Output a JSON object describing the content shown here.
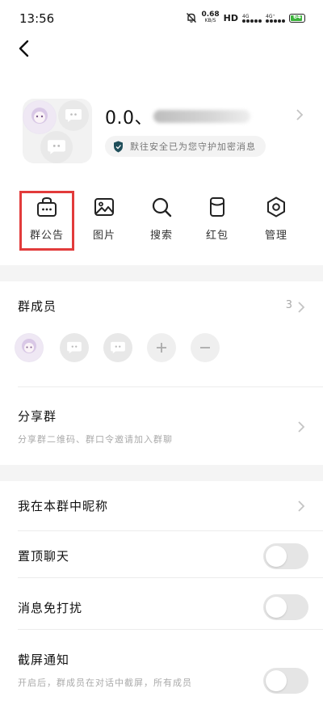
{
  "status": {
    "time": "13:56",
    "speed_value": "0.68",
    "speed_unit": "KB/S",
    "hd": "HD",
    "sig1": "4G",
    "sig2": "4G⁺",
    "battery": "64"
  },
  "group": {
    "name": "0.0、",
    "secure_text": "默往安全已为您守护加密消息"
  },
  "quick_actions": [
    {
      "label": "群公告",
      "icon": "bag-icon"
    },
    {
      "label": "图片",
      "icon": "image-icon"
    },
    {
      "label": "搜索",
      "icon": "search-icon"
    },
    {
      "label": "红包",
      "icon": "red-packet-icon"
    },
    {
      "label": "管理",
      "icon": "settings-hex-icon"
    }
  ],
  "members": {
    "title": "群成员",
    "count": "3"
  },
  "share": {
    "title": "分享群",
    "subtitle": "分享群二维码、群口令邀请加入群聊"
  },
  "settings": {
    "nickname_label": "我在本群中昵称",
    "pin_label": "置顶聊天",
    "mute_label": "消息免打扰",
    "screenshot_label": "截屏通知",
    "screenshot_sub": "开启后，群成员在对话中截屏，所有成员"
  },
  "colors": {
    "highlight": "#e23b3b",
    "shield": "#1f4e5a"
  }
}
